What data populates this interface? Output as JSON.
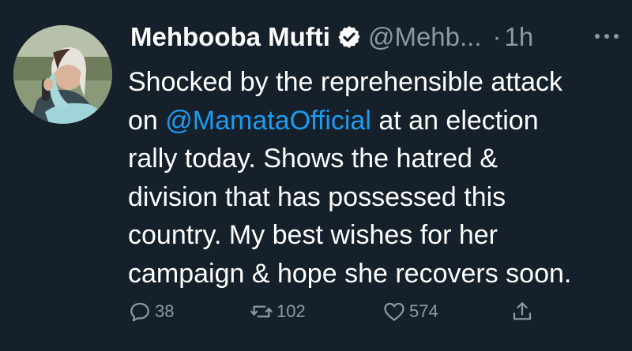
{
  "tweet": {
    "author_name": "Mehbooba Mufti",
    "handle": "@Mehb...",
    "separator": "·",
    "time": "1h",
    "body": {
      "line1": "Shocked by the reprehensible attack",
      "line2_prefix": "on ",
      "mention": "@MamataOfficial",
      "line2_suffix": " at an election",
      "line3": "rally today. Shows the hatred &",
      "line4": "division that has possessed this",
      "line5": "country. My best wishes for her",
      "line6": "campaign & hope she recovers soon."
    },
    "stats": {
      "replies": "38",
      "retweets": "102",
      "likes": "574"
    },
    "icons": {
      "verified": "verified-badge-icon",
      "more": "more-options-icon",
      "reply": "reply-icon",
      "retweet": "retweet-icon",
      "like": "heart-icon",
      "share": "share-icon"
    },
    "colors": {
      "background": "#15202b",
      "text": "#ffffff",
      "secondary": "#8b98a5",
      "link": "#1d9bf0"
    }
  }
}
